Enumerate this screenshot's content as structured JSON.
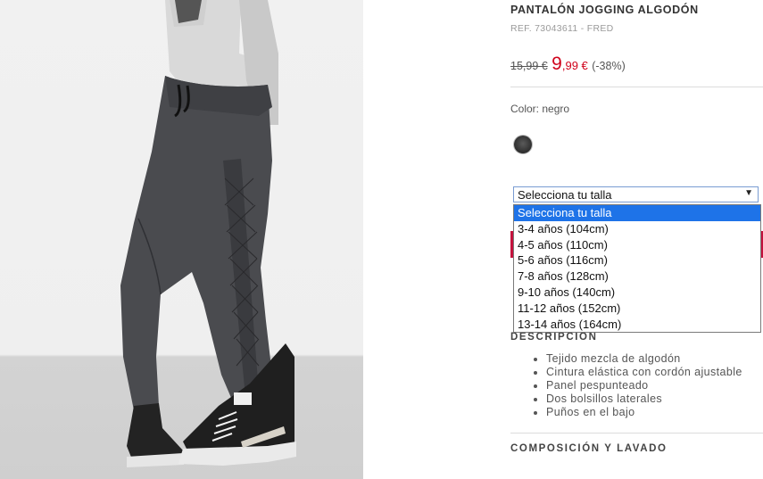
{
  "product": {
    "title": "PANTALÓN JOGGING ALGODÓN",
    "ref": "REF. 73043611 - FRED",
    "old_price": "15,99 €",
    "new_price_int": "9",
    "new_price_dec": ",99 €",
    "discount": "(-38%)"
  },
  "color": {
    "label": "Color: negro",
    "swatches": [
      {
        "name": "negro",
        "hex": "#333333"
      }
    ]
  },
  "size_select": {
    "selected": "Selecciona tu talla",
    "options": [
      "Selecciona tu talla",
      "3-4 años (104cm)",
      "4-5 años (110cm)",
      "5-6 años (116cm)",
      "7-8 años (128cm)",
      "9-10 años (140cm)",
      "11-12 años (152cm)",
      "13-14 años (164cm)"
    ]
  },
  "description": {
    "heading": "DESCRIPCIÓN",
    "items": [
      "Tejido mezcla de algodón",
      "Cintura elástica con cordón ajustable",
      "Panel pespunteado",
      "Dos bolsillos laterales",
      "Puños en el bajo"
    ]
  },
  "composition": {
    "heading": "COMPOSICIÓN Y LAVADO"
  },
  "colors": {
    "sale_red": "#d0021b",
    "cart_button": "#c4123d",
    "select_highlight": "#1e73e8"
  }
}
